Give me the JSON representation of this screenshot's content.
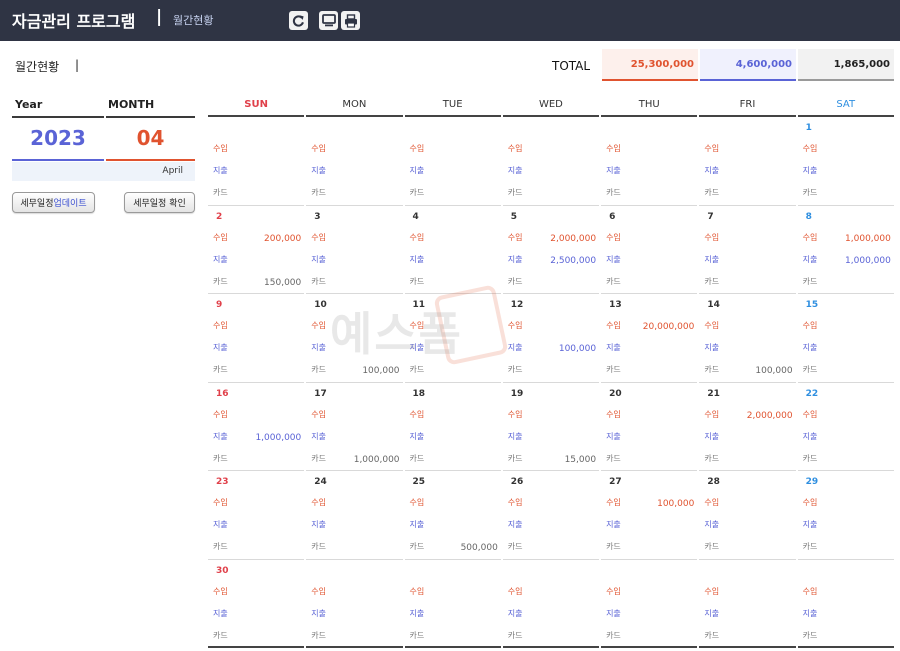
{
  "app": {
    "title": "자금관리 프로그램",
    "separator": "|",
    "subtitle": "월간현황"
  },
  "toolbar": {
    "buttons": [
      {
        "icon": "refresh-icon"
      },
      {
        "icon": "monitor-icon"
      },
      {
        "icon": "print-icon"
      }
    ]
  },
  "page": {
    "label": "월간현황",
    "bar": "|"
  },
  "selector": {
    "year_label": "Year",
    "month_label": "MONTH",
    "year": "2023",
    "month": "04",
    "month_name": "April",
    "btn_update_prefix": "세무일정 ",
    "btn_update_highlight": "업데이트",
    "btn_check": "세무일정 확인"
  },
  "totals": {
    "label": "TOTAL",
    "income": "25,300,000",
    "expense": "4,600,000",
    "card": "1,865,000"
  },
  "labels": {
    "income": "수입",
    "expense": "지출",
    "card": "카드"
  },
  "calendar": {
    "weekdays": [
      "SUN",
      "MON",
      "TUE",
      "WED",
      "THU",
      "FRI",
      "SAT"
    ],
    "weeks": [
      [
        {
          "day": "",
          "income": "",
          "expense": "",
          "card": ""
        },
        {
          "day": "",
          "income": "",
          "expense": "",
          "card": ""
        },
        {
          "day": "",
          "income": "",
          "expense": "",
          "card": ""
        },
        {
          "day": "",
          "income": "",
          "expense": "",
          "card": ""
        },
        {
          "day": "",
          "income": "",
          "expense": "",
          "card": ""
        },
        {
          "day": "",
          "income": "",
          "expense": "",
          "card": ""
        },
        {
          "day": "1",
          "income": "",
          "expense": "",
          "card": ""
        }
      ],
      [
        {
          "day": "2",
          "income": "200,000",
          "expense": "",
          "card": "150,000"
        },
        {
          "day": "3",
          "income": "",
          "expense": "",
          "card": ""
        },
        {
          "day": "4",
          "income": "",
          "expense": "",
          "card": ""
        },
        {
          "day": "5",
          "income": "2,000,000",
          "expense": "2,500,000",
          "card": ""
        },
        {
          "day": "6",
          "income": "",
          "expense": "",
          "card": ""
        },
        {
          "day": "7",
          "income": "",
          "expense": "",
          "card": ""
        },
        {
          "day": "8",
          "income": "1,000,000",
          "expense": "1,000,000",
          "card": ""
        }
      ],
      [
        {
          "day": "9",
          "income": "",
          "expense": "",
          "card": ""
        },
        {
          "day": "10",
          "income": "",
          "expense": "",
          "card": "100,000"
        },
        {
          "day": "11",
          "income": "",
          "expense": "",
          "card": ""
        },
        {
          "day": "12",
          "income": "",
          "expense": "100,000",
          "card": ""
        },
        {
          "day": "13",
          "income": "20,000,000",
          "expense": "",
          "card": ""
        },
        {
          "day": "14",
          "income": "",
          "expense": "",
          "card": "100,000"
        },
        {
          "day": "15",
          "income": "",
          "expense": "",
          "card": ""
        }
      ],
      [
        {
          "day": "16",
          "income": "",
          "expense": "1,000,000",
          "card": ""
        },
        {
          "day": "17",
          "income": "",
          "expense": "",
          "card": "1,000,000"
        },
        {
          "day": "18",
          "income": "",
          "expense": "",
          "card": ""
        },
        {
          "day": "19",
          "income": "",
          "expense": "",
          "card": "15,000"
        },
        {
          "day": "20",
          "income": "",
          "expense": "",
          "card": ""
        },
        {
          "day": "21",
          "income": "2,000,000",
          "expense": "",
          "card": ""
        },
        {
          "day": "22",
          "income": "",
          "expense": "",
          "card": ""
        }
      ],
      [
        {
          "day": "23",
          "income": "",
          "expense": "",
          "card": ""
        },
        {
          "day": "24",
          "income": "",
          "expense": "",
          "card": ""
        },
        {
          "day": "25",
          "income": "",
          "expense": "",
          "card": "500,000"
        },
        {
          "day": "26",
          "income": "",
          "expense": "",
          "card": ""
        },
        {
          "day": "27",
          "income": "100,000",
          "expense": "",
          "card": ""
        },
        {
          "day": "28",
          "income": "",
          "expense": "",
          "card": ""
        },
        {
          "day": "29",
          "income": "",
          "expense": "",
          "card": ""
        }
      ],
      [
        {
          "day": "30",
          "income": "",
          "expense": "",
          "card": ""
        },
        {
          "day": "",
          "income": "",
          "expense": "",
          "card": ""
        },
        {
          "day": "",
          "income": "",
          "expense": "",
          "card": ""
        },
        {
          "day": "",
          "income": "",
          "expense": "",
          "card": ""
        },
        {
          "day": "",
          "income": "",
          "expense": "",
          "card": ""
        },
        {
          "day": "",
          "income": "",
          "expense": "",
          "card": ""
        },
        {
          "day": "",
          "income": "",
          "expense": "",
          "card": ""
        }
      ]
    ]
  },
  "watermark": {
    "text": "예스폼"
  },
  "colors": {
    "header_bg": "#2f3444",
    "income": "#e0532f",
    "expense": "#5a63d6",
    "sunday": "#e0404a",
    "saturday": "#2f8fe0"
  }
}
